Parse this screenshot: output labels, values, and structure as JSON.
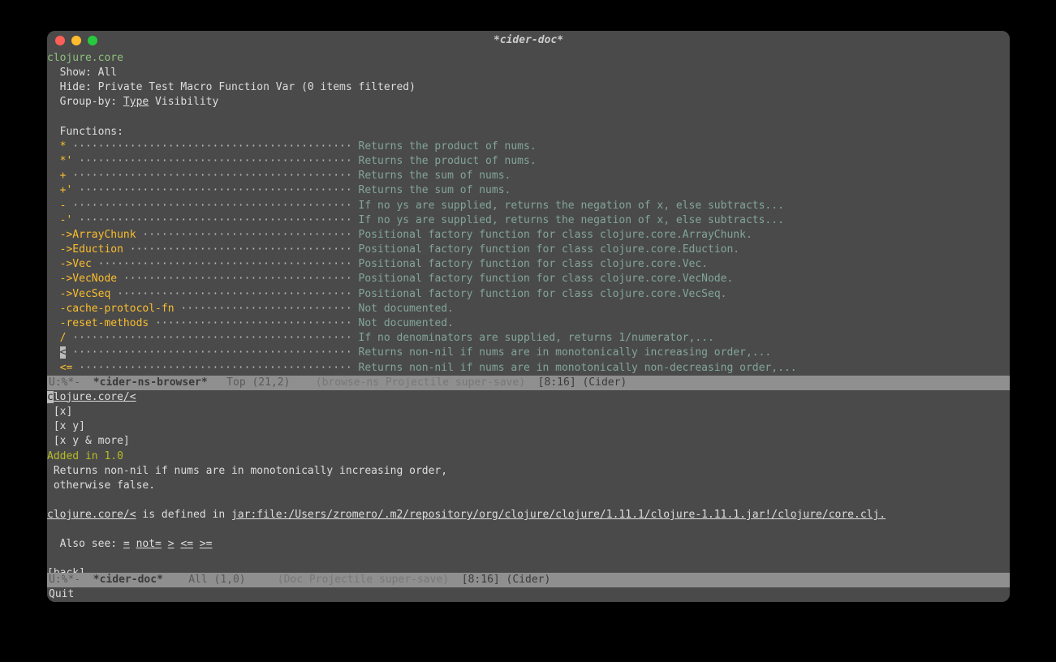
{
  "title": "*cider-doc*",
  "top": {
    "namespace": "clojure.core",
    "show_label": "  Show: ",
    "show_value": "All",
    "hide_label": "  Hide: ",
    "hide_value": "Private Test Macro Function Var (0 items filtered)",
    "group_label": "  Group-by: ",
    "group_type": "Type",
    "group_rest": " Visibility",
    "section": "  Functions:",
    "items": [
      {
        "name": "*",
        "doc": "Returns the product of nums."
      },
      {
        "name": "*'",
        "doc": "Returns the product of nums."
      },
      {
        "name": "+",
        "doc": "Returns the sum of nums."
      },
      {
        "name": "+'",
        "doc": "Returns the sum of nums."
      },
      {
        "name": "-",
        "doc": "If no ys are supplied, returns the negation of x, else subtracts..."
      },
      {
        "name": "-'",
        "doc": "If no ys are supplied, returns the negation of x, else subtracts..."
      },
      {
        "name": "->ArrayChunk",
        "doc": "Positional factory function for class clojure.core.ArrayChunk."
      },
      {
        "name": "->Eduction",
        "doc": "Positional factory function for class clojure.core.Eduction."
      },
      {
        "name": "->Vec",
        "doc": "Positional factory function for class clojure.core.Vec."
      },
      {
        "name": "->VecNode",
        "doc": "Positional factory function for class clojure.core.VecNode."
      },
      {
        "name": "->VecSeq",
        "doc": "Positional factory function for class clojure.core.VecSeq."
      },
      {
        "name": "-cache-protocol-fn",
        "doc": "Not documented."
      },
      {
        "name": "-reset-methods",
        "doc": "Not documented."
      },
      {
        "name": "/",
        "doc": "If no denominators are supplied, returns 1/numerator,..."
      },
      {
        "name": "<",
        "doc": "Returns non-nil if nums are in monotonically increasing order,...",
        "cursor": true
      },
      {
        "name": "<=",
        "doc": "Returns non-nil if nums are in monotonically non-decreasing order,..."
      }
    ]
  },
  "modeline1": {
    "prefix": "U:%*-  ",
    "buffer": "*cider-ns-browser*",
    "pos": "   Top (21,2)    ",
    "modes": "(browse-ns Projectile super-save)",
    "tail": "  [8:16] (Cider)"
  },
  "bottom": {
    "sym_first_char": "c",
    "sym_rest": "lojure.core/<",
    "arities": [
      " [x]",
      " [x y]",
      " [x y & more]"
    ],
    "added": "Added in 1.0",
    "docstring": [
      " Returns non-nil if nums are in monotonically increasing order,",
      " otherwise false."
    ],
    "defined_sym": "clojure.core/<",
    "defined_mid": " is defined in ",
    "defined_path": "jar:file:/Users/zromero/.m2/repository/org/clojure/clojure/1.11.1/clojure-1.11.1.jar!/clojure/core.clj.",
    "also_label": "  Also see: ",
    "also": [
      "=",
      "not=",
      ">",
      "<=",
      ">="
    ],
    "back": "[back]"
  },
  "modeline2": {
    "prefix": "U:%*-  ",
    "buffer": "*cider-doc*",
    "pos": "    All (1,0)     ",
    "modes": "(Doc Projectile super-save)",
    "tail": "  [8:16] (Cider)"
  },
  "echo": "Quit"
}
